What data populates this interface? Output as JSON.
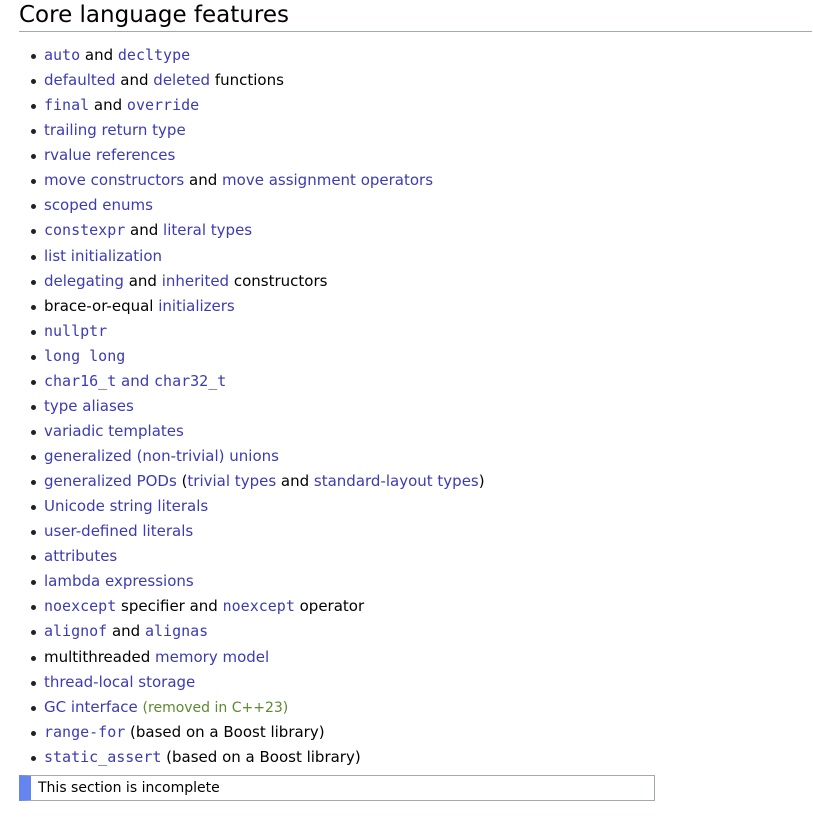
{
  "section": {
    "title": "Core language features"
  },
  "items": [
    [
      {
        "t": "auto",
        "l": true,
        "c": true
      },
      {
        "t": " and "
      },
      {
        "t": "decltype",
        "l": true,
        "c": true
      }
    ],
    [
      {
        "t": "defaulted",
        "l": true
      },
      {
        "t": " and "
      },
      {
        "t": "deleted",
        "l": true
      },
      {
        "t": " functions"
      }
    ],
    [
      {
        "t": "final",
        "l": true,
        "c": true
      },
      {
        "t": " and "
      },
      {
        "t": "override",
        "l": true,
        "c": true
      }
    ],
    [
      {
        "t": "trailing return type",
        "l": true
      }
    ],
    [
      {
        "t": "rvalue references",
        "l": true
      }
    ],
    [
      {
        "t": "move constructors",
        "l": true
      },
      {
        "t": " and "
      },
      {
        "t": "move assignment operators",
        "l": true
      }
    ],
    [
      {
        "t": "scoped enums",
        "l": true
      }
    ],
    [
      {
        "t": "constexpr",
        "l": true,
        "c": true
      },
      {
        "t": " and "
      },
      {
        "t": "literal types",
        "l": true
      }
    ],
    [
      {
        "t": "list initialization",
        "l": true
      }
    ],
    [
      {
        "t": "delegating",
        "l": true
      },
      {
        "t": " and "
      },
      {
        "t": "inherited",
        "l": true
      },
      {
        "t": " constructors"
      }
    ],
    [
      {
        "t": "brace-or-equal "
      },
      {
        "t": "initializers",
        "l": true
      }
    ],
    [
      {
        "t": "nullptr",
        "l": true,
        "c": true
      }
    ],
    [
      {
        "t": "long long",
        "l": true,
        "c": true
      }
    ],
    [
      {
        "t": "char16_t",
        "l": true,
        "c": true
      },
      {
        "t": " and ",
        "l": true
      },
      {
        "t": "char32_t",
        "l": true,
        "c": true
      }
    ],
    [
      {
        "t": "type aliases",
        "l": true
      }
    ],
    [
      {
        "t": "variadic templates",
        "l": true
      }
    ],
    [
      {
        "t": "generalized (non-trivial) unions",
        "l": true
      }
    ],
    [
      {
        "t": "generalized PODs",
        "l": true
      },
      {
        "t": " ("
      },
      {
        "t": "trivial types",
        "l": true
      },
      {
        "t": " and "
      },
      {
        "t": "standard-layout types",
        "l": true
      },
      {
        "t": ")"
      }
    ],
    [
      {
        "t": "Unicode string literals",
        "l": true
      }
    ],
    [
      {
        "t": "user-defined literals",
        "l": true
      }
    ],
    [
      {
        "t": "attributes",
        "l": true
      }
    ],
    [
      {
        "t": "lambda expressions",
        "l": true
      }
    ],
    [
      {
        "t": "noexcept",
        "l": true,
        "c": true
      },
      {
        "t": " specifier and "
      },
      {
        "t": "noexcept",
        "l": true,
        "c": true
      },
      {
        "t": " operator"
      }
    ],
    [
      {
        "t": "alignof",
        "l": true,
        "c": true
      },
      {
        "t": " and "
      },
      {
        "t": "alignas",
        "l": true,
        "c": true
      }
    ],
    [
      {
        "t": "multithreaded "
      },
      {
        "t": "memory model",
        "l": true
      }
    ],
    [
      {
        "t": "thread-local storage",
        "l": true
      }
    ],
    [
      {
        "t": "GC interface",
        "l": true
      },
      {
        "t": " "
      },
      {
        "t": "(removed in C++23)",
        "n": true
      }
    ],
    [
      {
        "t": "range-for",
        "l": true,
        "c": true
      },
      {
        "t": " (based on a Boost library)"
      }
    ],
    [
      {
        "t": "static_assert",
        "l": true,
        "c": true
      },
      {
        "t": " (based on a Boost library)"
      }
    ]
  ],
  "notice": {
    "text": "This section is incomplete"
  },
  "colors": {
    "link": "#3b3bb4",
    "note": "#5b8a2f",
    "notice_bar": "#6485ef"
  }
}
